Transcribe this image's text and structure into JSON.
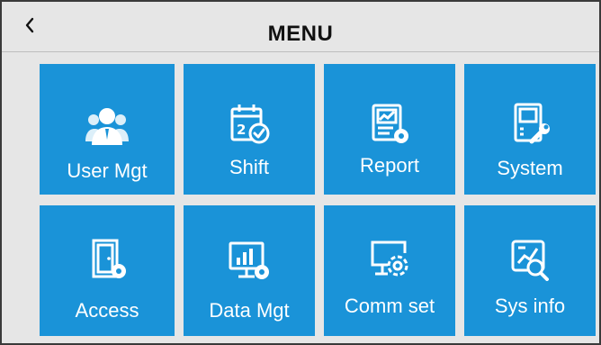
{
  "header": {
    "title": "MENU"
  },
  "menu": {
    "items": [
      {
        "label": "User Mgt",
        "icon": "users-icon"
      },
      {
        "label": "Shift",
        "icon": "calendar-check-icon"
      },
      {
        "label": "Report",
        "icon": "report-gear-icon"
      },
      {
        "label": "System",
        "icon": "device-wrench-icon"
      },
      {
        "label": "Access",
        "icon": "door-gear-icon"
      },
      {
        "label": "Data Mgt",
        "icon": "monitor-chart-gear-icon"
      },
      {
        "label": "Comm set",
        "icon": "monitor-gear-icon"
      },
      {
        "label": "Sys info",
        "icon": "chart-magnifier-icon"
      }
    ]
  },
  "colors": {
    "tile": "#1a93d8",
    "background": "#e6e6e6",
    "text_on_tile": "#ffffff"
  }
}
